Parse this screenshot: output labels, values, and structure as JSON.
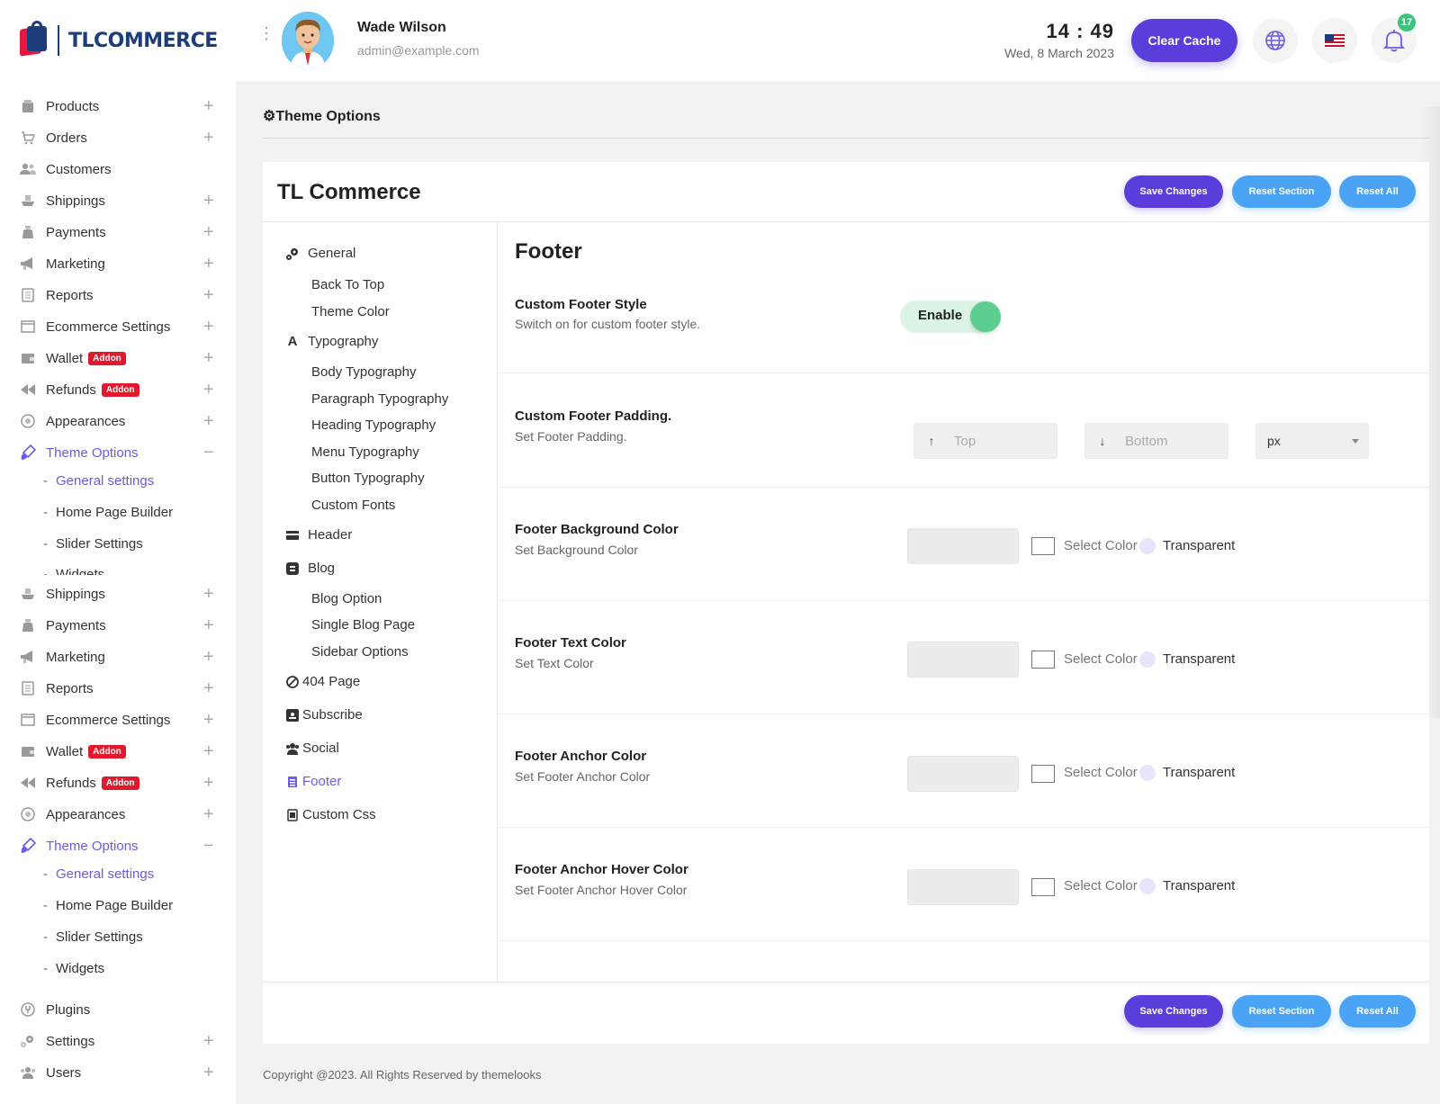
{
  "brand": {
    "name": "TLCOMMERCE"
  },
  "user": {
    "name": "Wade Wilson",
    "email": "admin@example.com"
  },
  "clock": {
    "time": "14 : 49",
    "date": "Wed, 8 March 2023"
  },
  "header": {
    "clear_cache_label": "Clear Cache",
    "notification_count": "17",
    "accent": "#5a3ddb"
  },
  "sidebar": {
    "items": [
      {
        "label": "Products",
        "icon": "box-icon"
      },
      {
        "label": "Orders",
        "icon": "cart-icon"
      },
      {
        "label": "Customers",
        "icon": "users-icon"
      },
      {
        "label": "Shippings",
        "icon": "ship-icon"
      },
      {
        "label": "Payments",
        "icon": "money-bag-icon"
      },
      {
        "label": "Marketing",
        "icon": "megaphone-icon"
      },
      {
        "label": "Reports",
        "icon": "report-icon"
      },
      {
        "label": "Ecommerce Settings",
        "icon": "window-icon"
      },
      {
        "label": "Wallet",
        "icon": "wallet-icon",
        "badge": "Addon"
      },
      {
        "label": "Refunds",
        "icon": "rewind-icon",
        "badge": "Addon"
      },
      {
        "label": "Appearances",
        "icon": "palette-icon"
      },
      {
        "label": "Theme Options",
        "icon": "brush-icon"
      }
    ],
    "theme_sub": [
      "General settings",
      "Home Page Builder",
      "Slider Settings",
      "Widgets"
    ],
    "items2": [
      {
        "label": "Shippings"
      },
      {
        "label": "Payments"
      },
      {
        "label": "Marketing"
      },
      {
        "label": "Reports"
      },
      {
        "label": "Ecommerce Settings"
      },
      {
        "label": "Wallet",
        "badge": "Addon"
      },
      {
        "label": "Refunds",
        "badge": "Addon"
      },
      {
        "label": "Appearances"
      },
      {
        "label": "Theme Options"
      }
    ],
    "theme_sub2": [
      "General settings",
      "Home Page Builder",
      "Slider Settings",
      "Widgets"
    ],
    "tail": [
      {
        "label": "Plugins"
      },
      {
        "label": "Settings"
      },
      {
        "label": "Users"
      }
    ]
  },
  "page": {
    "title": "Theme Options"
  },
  "card": {
    "title": "TL Commerce",
    "save_label": "Save Changes",
    "reset_section_label": "Reset Section",
    "reset_all_label": "Reset All"
  },
  "theme_nav": {
    "general": "General",
    "general_sub": [
      "Back To Top",
      "Theme Color"
    ],
    "typography": "Typography",
    "typography_sub": [
      "Body Typography",
      "Paragraph Typography",
      "Heading Typography",
      "Menu Typography",
      "Button Typography",
      "Custom Fonts"
    ],
    "header": "Header",
    "blog": "Blog",
    "blog_sub": [
      "Blog Option",
      "Single Blog Page",
      "Sidebar Options"
    ],
    "page404": "404 Page",
    "subscribe": "Subscribe",
    "social": "Social",
    "footer": "Footer",
    "custom_css": "Custom Css"
  },
  "footer_section": {
    "title": "Footer",
    "custom_style": {
      "label": "Custom Footer Style",
      "desc": "Switch on for custom footer style.",
      "toggle_label": "Enable",
      "enabled": true
    },
    "padding": {
      "label": "Custom Footer Padding.",
      "desc": "Set Footer Padding.",
      "top_placeholder": "Top",
      "bottom_placeholder": "Bottom",
      "unit": "px"
    },
    "colors": [
      {
        "label": "Footer Background Color",
        "desc": "Set Background Color"
      },
      {
        "label": "Footer Text Color",
        "desc": "Set Text Color"
      },
      {
        "label": "Footer Anchor Color",
        "desc": "Set Footer Anchor Color"
      },
      {
        "label": "Footer Anchor Hover Color",
        "desc": "Set Footer Anchor Hover Color"
      }
    ],
    "select_color_label": "Select Color",
    "transparent_label": "Transparent"
  },
  "copyright": "Copyright @2023. All Rights Reserved by themelooks"
}
